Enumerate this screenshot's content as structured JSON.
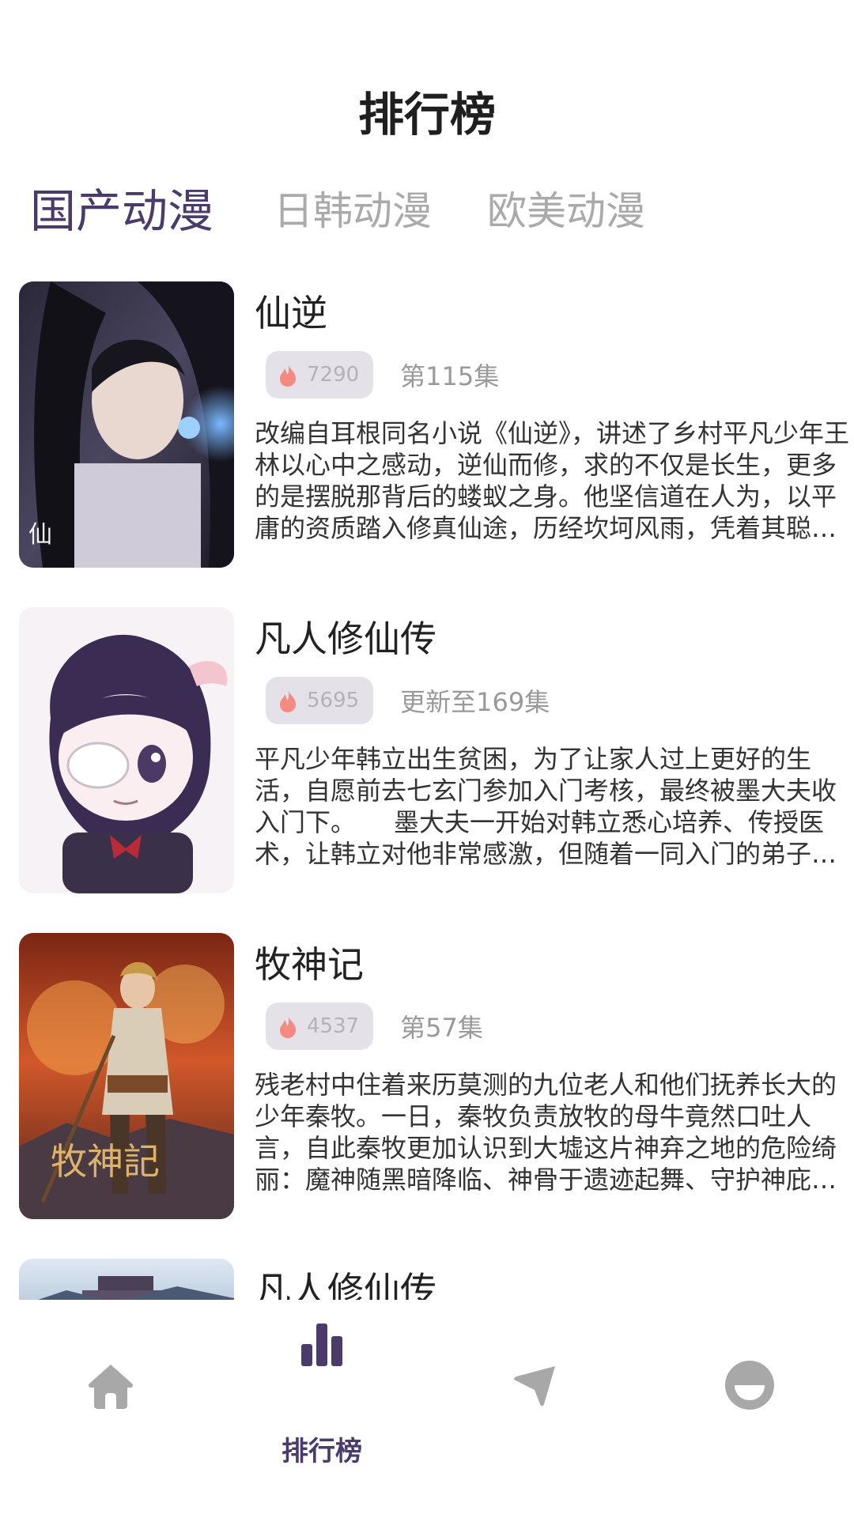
{
  "header": {
    "title": "排行榜"
  },
  "tabs": [
    {
      "label": "国产动漫",
      "active": true
    },
    {
      "label": "日韩动漫",
      "active": false
    },
    {
      "label": "欧美动漫",
      "active": false
    }
  ],
  "list": [
    {
      "title": "仙逆",
      "hot": "7290",
      "episode": "第115集",
      "description": "改编自耳根同名小说《仙逆》，讲述了乡村平凡少年王林以心中之感动，逆仙而修，求的不仅是长生，更多的是摆脱那背后的蝼蚁之身。他坚信道在人为，以平庸的资质踏入修真仙途，历经坎坷风雨，凭着其聪睿的心智，一步步走向巅峰，凭一己之力，扬名修真界。",
      "cover": "xianni-cover"
    },
    {
      "title": "凡人修仙传",
      "hot": "5695",
      "episode": "更新至169集",
      "description": "平凡少年韩立出生贫困，为了让家人过上更好的生活，自愿前去七玄门参加入门考核，最终被墨大夫收入门下。　　墨大夫一开始对韩立悉心培养、传授医术，让韩立对他非常感激，但随着一同入门的弟子张铁离奇失踪，韩立渐渐发现了墨大夫的阴谋。",
      "cover": "fanren-cover"
    },
    {
      "title": "牧神记",
      "hot": "4537",
      "episode": "第57集",
      "description": "残老村中住着来历莫测的九位老人和他们抚养长大的少年秦牧。一日，秦牧负责放牧的母牛竟然口吐人言，自此秦牧更加认识到大墟这片神弃之地的危险绮丽：魔神随黑暗降临、神骨于遗迹起舞、守护神庇佑一方。",
      "cover": "mushenji-cover"
    },
    {
      "title": "凡人修仙传",
      "hot": "",
      "episode": "",
      "description": "",
      "cover": "fanren2-cover"
    }
  ],
  "bottom_nav": {
    "items": [
      {
        "icon": "home-icon",
        "label": ""
      },
      {
        "icon": "bar-chart-icon",
        "label": "排行榜",
        "active": true
      },
      {
        "icon": "send-icon",
        "label": ""
      },
      {
        "icon": "profile-icon",
        "label": ""
      }
    ]
  },
  "colors": {
    "accent": "#4a3b6b",
    "inactive_tab": "#aaaaaa",
    "hot_badge_bg": "#e4e1e8",
    "flame": "#f48a82",
    "nav_icon_inactive": "#a8a8a8"
  }
}
